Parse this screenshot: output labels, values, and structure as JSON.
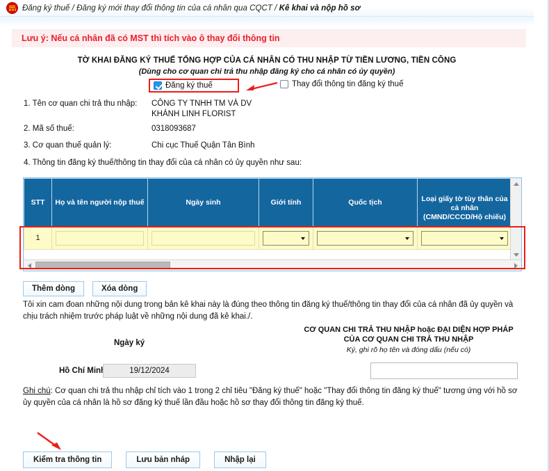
{
  "breadcrumb": {
    "icon": "vietnam-emblem-icon",
    "part1": "Đăng ký thuế / Đăng ký mới thay đổi thông tin của cá nhân qua CQCT / ",
    "current": "Kê khai và nộp hồ sơ"
  },
  "notice": {
    "text": "Lưu ý: Nếu cá nhân đã có MST thì tích vào ô thay đổi thông tin",
    "color": "#e8202a",
    "background": "#fdeef0"
  },
  "title": {
    "main": "TỜ KHAI ĐĂNG KÝ THUẾ TỔNG HỢP CỦA CÁ NHÂN CÓ THU NHẬP TỪ TIỀN LƯƠNG, TIỀN CÔNG",
    "sub": "(Dùng cho cơ quan chi trả thu nhập đăng ký cho cá nhân có ủy quyền)"
  },
  "checkboxes": {
    "register": {
      "label": "Đăng ký thuế",
      "checked": true,
      "highlighted": true
    },
    "change": {
      "label": "Thay đổi thông tin đăng ký thuế",
      "checked": false,
      "highlighted": false
    }
  },
  "fields": [
    {
      "label": "1. Tên cơ quan chi trả thu nhập:",
      "value": "CÔNG TY TNHH TM VÀ DV",
      "value2": "KHÁNH LINH FLORIST"
    },
    {
      "label": "2. Mã số thuế:",
      "value": "0318093687"
    },
    {
      "label": "3. Cơ quan thuế quản lý:",
      "value": "Chi cục Thuế Quận Tân Bình"
    }
  ],
  "section4_label": "4. Thông tin đăng ký thuế/thông tin thay đổi của cá nhân có ủy quyền như sau:",
  "table": {
    "headers": [
      "STT",
      "Họ và tên người nộp thuế",
      "Ngày sinh",
      "Giới tính",
      "Quốc tịch",
      "Loại giấy tờ tùy thân của cá nhân (CMND/CCCD/Hộ chiếu)",
      ""
    ],
    "header_bg": "#14669f",
    "row_bg": "#fdfbc8",
    "rows": [
      {
        "stt": "1",
        "name": "",
        "name_placeholder": "",
        "dob": "",
        "dob_placeholder": "",
        "gender": "",
        "nationality": "",
        "id_type": "",
        "extra": ""
      }
    ],
    "scrollbars": {
      "vertical": true,
      "horizontal": true
    }
  },
  "row_buttons": [
    {
      "label": "Thêm dòng",
      "name": "add-row-button"
    },
    {
      "label": "Xóa dòng",
      "name": "delete-row-button"
    }
  ],
  "commitment": "Tôi xin cam đoan những nội dung trong bản kê khai này là đúng theo thông tin đăng ký thuế/thông tin thay đổi của cá nhân đã ủy quyền và chịu trách nhiệm trước pháp luật về những nội dung đã kê khai./.",
  "signature": {
    "date_label": "Ngày ký",
    "city_label": "Hồ Chí Minh,",
    "date_value": "19/12/2024",
    "right_line1": "CƠ QUAN CHI TRẢ THU NHẬP hoặc ĐẠI DIỆN HỢP PHÁP",
    "right_line2": "CỦA CƠ QUAN CHI TRẢ THU NHẬP",
    "right_line3": "Ký, ghi rõ họ tên và đóng dấu (nếu có)",
    "sign_value": ""
  },
  "note": {
    "prefix": "Ghi chú",
    "text": ": Cơ quan chi trả thu nhập chỉ tích vào 1 trong 2 chỉ tiêu \"Đăng ký thuế\" hoặc \"Thay đổi thông tin đăng ký thuế\" tương ứng với hồ sơ ủy quyền của cá nhân là hồ sơ đăng ký thuế lần đầu hoặc hồ sơ thay đổi thông tin đăng ký thuế."
  },
  "bottom_buttons": [
    {
      "label": "Kiểm tra thông tin",
      "name": "check-information-button"
    },
    {
      "label": "Lưu bản nháp",
      "name": "save-draft-button"
    },
    {
      "label": "Nhập lại",
      "name": "reset-button"
    }
  ],
  "annotations": {
    "arrow_color": "#ee1b18",
    "highlight_color": "#ee1b18"
  }
}
